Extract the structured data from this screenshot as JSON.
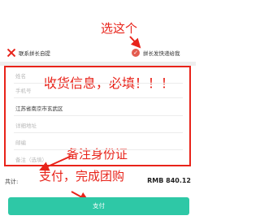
{
  "annotations": {
    "select_this": "选这个",
    "fill_info": "收货信息，必填！！！",
    "remark_id": "备注身份证",
    "pay_group": "支付，完成团购"
  },
  "delivery": {
    "self_pickup_label": "联系拼长自提",
    "express_label": "拼长发快递给我",
    "self_pickup_marked_x": true,
    "express_selected": true
  },
  "form": {
    "name_placeholder": "姓名",
    "phone_placeholder": "手机号",
    "region_value": "江苏省南京市玄武区",
    "address_placeholder": "详细地址",
    "postcode_placeholder": "邮编",
    "remark_placeholder": "备注（选填）"
  },
  "footer": {
    "total_label": "共计:",
    "total_amount": "RMB 840.12",
    "pay_label": "支付"
  },
  "colors": {
    "annotation_red": "#e8231a",
    "pay_button": "#2ec8a6",
    "check_badge": "#e35b4f"
  }
}
